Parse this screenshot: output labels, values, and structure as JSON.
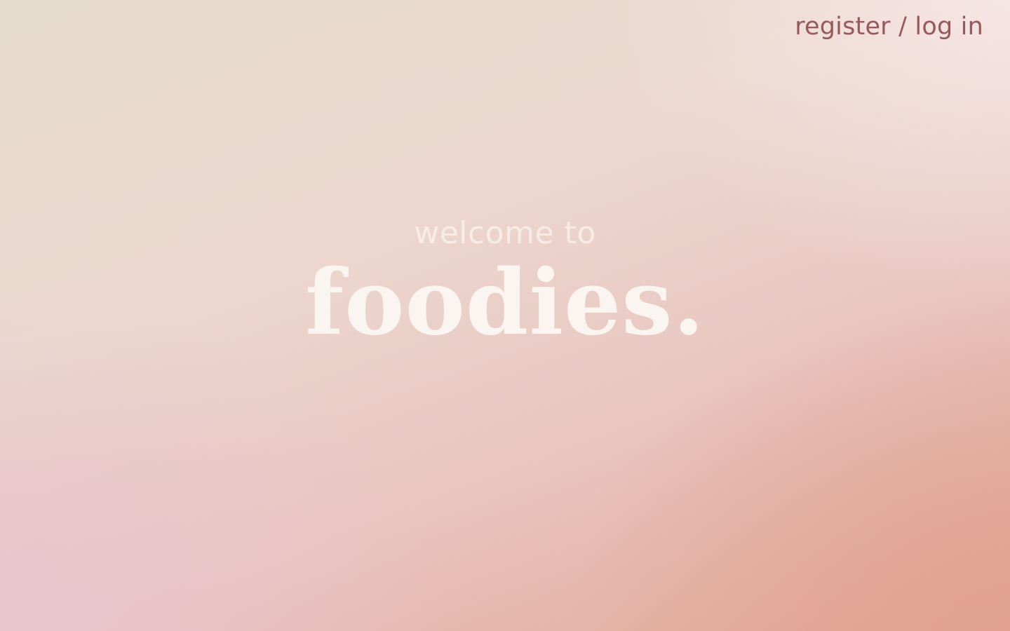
{
  "header": {
    "auth_link_label": "register / log in"
  },
  "hero": {
    "welcome_text": "welcome to",
    "brand_name": "foodies."
  },
  "colors": {
    "auth_link": "#96595c",
    "brand_text": "#fbf5f2",
    "gradient_top_left": "#e6dccb",
    "gradient_bottom_right": "#e3a796",
    "gradient_bottom_left": "#e8c4d2"
  }
}
